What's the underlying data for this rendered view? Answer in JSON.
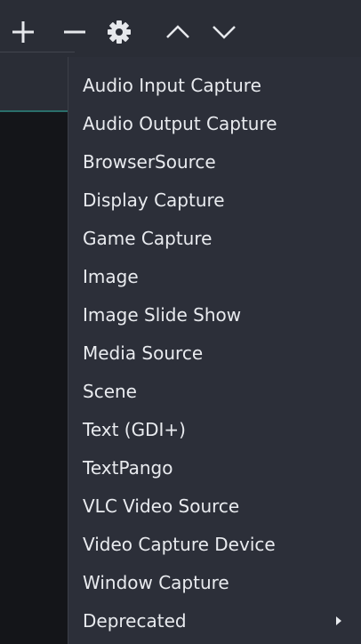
{
  "toolbar": {
    "buttons": [
      {
        "icon": "plus-icon"
      },
      {
        "icon": "minus-icon"
      },
      {
        "icon": "gear-icon"
      },
      {
        "icon": "chevron-up-icon"
      },
      {
        "icon": "chevron-down-icon"
      }
    ],
    "icon_color": "#e6e8ec"
  },
  "menu": {
    "items": [
      {
        "label": "Audio Input Capture"
      },
      {
        "label": "Audio Output Capture"
      },
      {
        "label": "BrowserSource"
      },
      {
        "label": "Display Capture"
      },
      {
        "label": "Game Capture"
      },
      {
        "label": "Image"
      },
      {
        "label": "Image Slide Show"
      },
      {
        "label": "Media Source"
      },
      {
        "label": "Scene"
      },
      {
        "label": "Text (GDI+)"
      },
      {
        "label": "TextPango"
      },
      {
        "label": "VLC Video Source"
      },
      {
        "label": "Video Capture Device"
      },
      {
        "label": "Window Capture"
      },
      {
        "label": "Deprecated",
        "submenu": true
      }
    ]
  },
  "colors": {
    "menu_bg": "#2c2f39",
    "text": "#e9ebef",
    "accent_teal": "#2a6e6a"
  }
}
